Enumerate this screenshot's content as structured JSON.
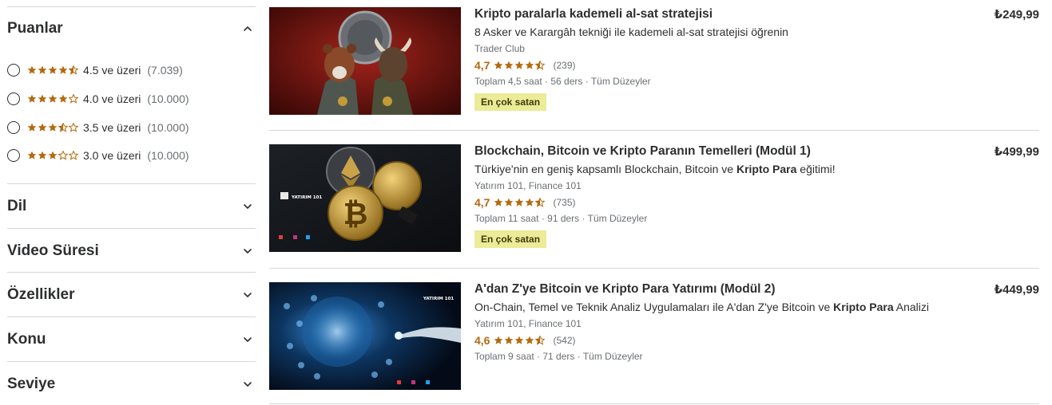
{
  "sidebar": {
    "ratings": {
      "title": "Puanlar",
      "options": [
        {
          "stars": 4.5,
          "label": "4.5 ve üzeri",
          "count": "(7.039)"
        },
        {
          "stars": 4.0,
          "label": "4.0 ve üzeri",
          "count": "(10.000)"
        },
        {
          "stars": 3.5,
          "label": "3.5 ve üzeri",
          "count": "(10.000)"
        },
        {
          "stars": 3.0,
          "label": "3.0 ve üzeri",
          "count": "(10.000)"
        }
      ]
    },
    "sections": [
      "Dil",
      "Video Süresi",
      "Özellikler",
      "Konu",
      "Seviye"
    ]
  },
  "courses": [
    {
      "title": "Kripto paralarla kademeli al-sat stratejisi",
      "description": "8 Asker ve Karargâh tekniği ile kademeli al-sat stratejisi öğrenin",
      "instructor": "Trader Club",
      "rating": "4,7",
      "rating_value": 4.7,
      "reviews": "(239)",
      "meta": "Toplam 4,5 saat · 56 ders · Tüm Düzeyler",
      "badge": "En çok satan",
      "price": "₺249,99"
    },
    {
      "title": "Blockchain, Bitcoin ve Kripto Paranın Temelleri (Modül 1)",
      "description_parts": [
        "Türkiye'nin en geniş kapsamlı Blockchain, Bitcoin ve ",
        "Kripto Para",
        " eğitimi!"
      ],
      "instructor": "Yatırım 101, Finance 101",
      "rating": "4,7",
      "rating_value": 4.7,
      "reviews": "(735)",
      "meta": "Toplam 11 saat · 91 ders · Tüm Düzeyler",
      "badge": "En çok satan",
      "price": "₺499,99",
      "thumb_brand": "YATIRIM 101"
    },
    {
      "title": "A'dan Z'ye Bitcoin ve Kripto Para Yatırımı (Modül 2)",
      "description_parts": [
        "On-Chain, Temel ve Teknik Analiz Uygulamaları ile A'dan Z'ye Bitcoin ve ",
        "Kripto Para",
        " Analizi"
      ],
      "instructor": "Yatırım 101, Finance 101",
      "rating": "4,6",
      "rating_value": 4.6,
      "reviews": "(542)",
      "meta": "Toplam 9 saat · 71 ders · Tüm Düzeyler",
      "price": "₺449,99",
      "thumb_brand": "YATIRIM 101"
    }
  ],
  "colors": {
    "star": "#b4690e",
    "badge_bg": "#eceb98",
    "text": "#2d2f31",
    "muted": "#6a6f73",
    "divider": "#d1d7dc"
  }
}
